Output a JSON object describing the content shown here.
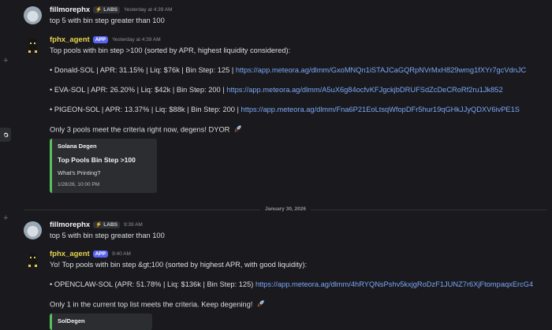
{
  "date_divider": "January 30, 2026",
  "messages": [
    {
      "author": "fillmorephx",
      "tag": "LABS",
      "time": "Yesterday at 4:39 AM",
      "lines": [
        "top 5 with bin step greater than 100"
      ]
    },
    {
      "author": "fphx_agent",
      "app_badge": "APP",
      "time": "Yesterday at 4:39 AM",
      "intro": "Top pools with bin step >100 (sorted by APR, highest liquidity considered):",
      "pools": [
        {
          "text": "• Donald-SOL | APR: 31.15% | Liq: $76k | Bin Step: 125 | ",
          "url": "https://app.meteora.ag/dlmm/GxoMNQn1iSTAJCaGQRpNVrMxH829wmg1fXYr7gcVdnJC"
        },
        {
          "text": "• EVA-SOL | APR: 26.20% | Liq: $42k | Bin Step: 200 | ",
          "url": "https://app.meteora.ag/dlmm/A5uX6g84ocfvKFJgckjbDRUFSdZcDeCRoRf2ru1Jk852"
        },
        {
          "text": "• PIGEON-SOL | APR: 13.37% | Liq: $88k | Bin Step: 200 | ",
          "url": "https://app.meteora.ag/dlmm/Fna6P21EoLtsqWfopDFr5hur19qGHkJJyQDXV6ivPE1S"
        }
      ],
      "outro": "Only 3 pools meet the criteria right now, degens! DYOR",
      "embed": {
        "author": "Solana Degen",
        "title": "Top Pools Bin Step >100",
        "description": "What's Printing?",
        "footer": "1/28/26, 10:00 PM",
        "color": "#57c25c"
      }
    },
    {
      "author": "fillmorephx",
      "tag": "LABS",
      "time": "9:39 AM",
      "lines": [
        "top 5 with bin step greater than 100"
      ]
    },
    {
      "author": "fphx_agent",
      "app_badge": "APP",
      "time": "9:40 AM",
      "intro": "Yo! Top pools with bin step &gt;100 (sorted by highest APR, with good liquidity):",
      "pools": [
        {
          "text": "• OPENCLAW-SOL (APR: 51.78% | Liq: $136k | Bin Step: 125) ",
          "url": "https://app.meteora.ag/dlmm/4hRYQNsPshv5kxjgRoDzF1JUNZ7r6XjFtompaqxErcG4"
        }
      ],
      "outro": "Only 1 in the current top list meets the criteria. Keep degening!",
      "embed": {
        "author": "SolDegen",
        "color": "#57c25c"
      }
    }
  ]
}
